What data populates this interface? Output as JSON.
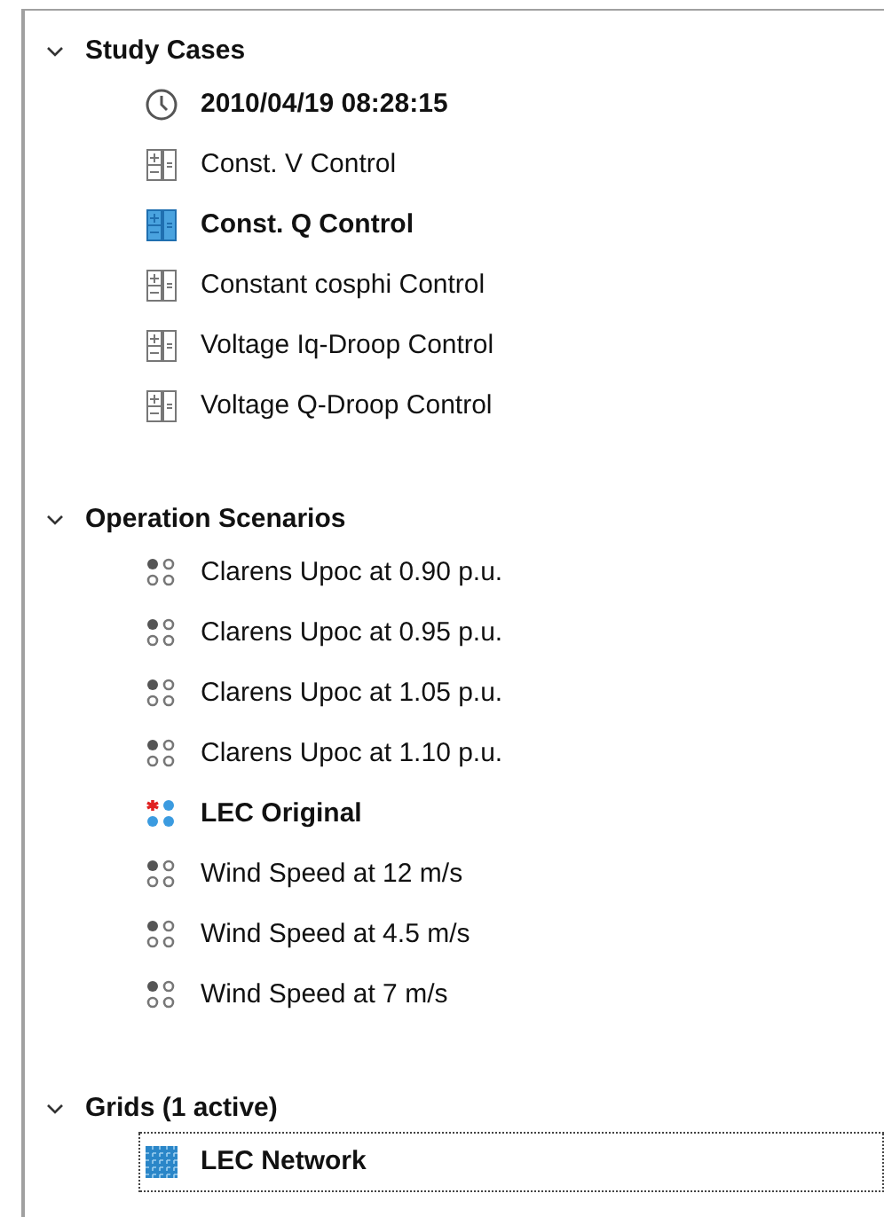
{
  "groups": [
    {
      "label": "Study Cases",
      "expanded": true,
      "children": [
        {
          "kind": "time",
          "label": "2010/04/19 08:28:15",
          "active": true
        },
        {
          "kind": "case",
          "label": "Const. V Control",
          "active": false
        },
        {
          "kind": "case",
          "label": "Const. Q Control",
          "active": true
        },
        {
          "kind": "case",
          "label": "Constant cosphi Control",
          "active": false
        },
        {
          "kind": "case",
          "label": "Voltage Iq-Droop Control",
          "active": false
        },
        {
          "kind": "case",
          "label": "Voltage Q-Droop Control",
          "active": false
        }
      ]
    },
    {
      "label": "Operation Scenarios",
      "expanded": true,
      "children": [
        {
          "kind": "scenario",
          "label": "Clarens Upoc at 0.90 p.u.",
          "active": false
        },
        {
          "kind": "scenario",
          "label": "Clarens Upoc at 0.95 p.u.",
          "active": false
        },
        {
          "kind": "scenario",
          "label": "Clarens Upoc at 1.05 p.u.",
          "active": false
        },
        {
          "kind": "scenario",
          "label": "Clarens Upoc at 1.10 p.u.",
          "active": false
        },
        {
          "kind": "scenario",
          "label": "LEC Original",
          "active": true
        },
        {
          "kind": "scenario",
          "label": "Wind Speed at 12 m/s",
          "active": false
        },
        {
          "kind": "scenario",
          "label": "Wind Speed at 4.5 m/s",
          "active": false
        },
        {
          "kind": "scenario",
          "label": "Wind Speed at 7 m/s",
          "active": false
        }
      ]
    },
    {
      "label": "Grids (1 active)",
      "expanded": true,
      "children": [
        {
          "kind": "grid",
          "label": "LEC Network",
          "active": true,
          "focused": true
        }
      ]
    }
  ]
}
